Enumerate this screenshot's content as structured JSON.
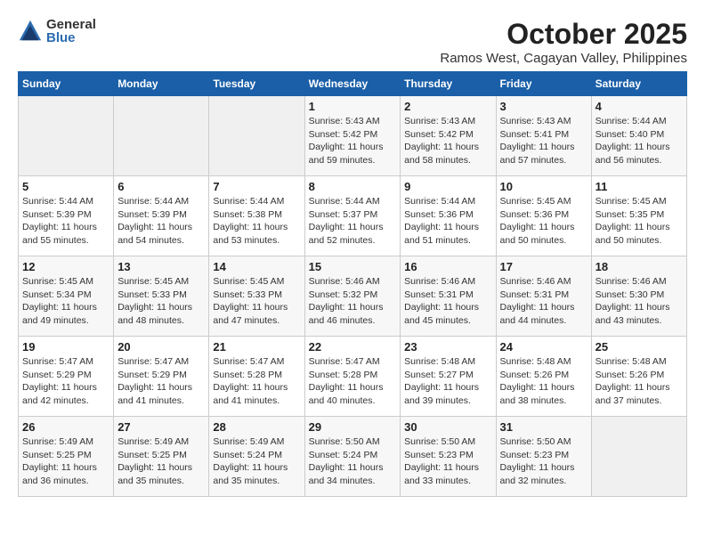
{
  "logo": {
    "general": "General",
    "blue": "Blue"
  },
  "title": "October 2025",
  "location": "Ramos West, Cagayan Valley, Philippines",
  "weekdays": [
    "Sunday",
    "Monday",
    "Tuesday",
    "Wednesday",
    "Thursday",
    "Friday",
    "Saturday"
  ],
  "weeks": [
    [
      {
        "day": "",
        "info": ""
      },
      {
        "day": "",
        "info": ""
      },
      {
        "day": "",
        "info": ""
      },
      {
        "day": "1",
        "info": "Sunrise: 5:43 AM\nSunset: 5:42 PM\nDaylight: 11 hours\nand 59 minutes."
      },
      {
        "day": "2",
        "info": "Sunrise: 5:43 AM\nSunset: 5:42 PM\nDaylight: 11 hours\nand 58 minutes."
      },
      {
        "day": "3",
        "info": "Sunrise: 5:43 AM\nSunset: 5:41 PM\nDaylight: 11 hours\nand 57 minutes."
      },
      {
        "day": "4",
        "info": "Sunrise: 5:44 AM\nSunset: 5:40 PM\nDaylight: 11 hours\nand 56 minutes."
      }
    ],
    [
      {
        "day": "5",
        "info": "Sunrise: 5:44 AM\nSunset: 5:39 PM\nDaylight: 11 hours\nand 55 minutes."
      },
      {
        "day": "6",
        "info": "Sunrise: 5:44 AM\nSunset: 5:39 PM\nDaylight: 11 hours\nand 54 minutes."
      },
      {
        "day": "7",
        "info": "Sunrise: 5:44 AM\nSunset: 5:38 PM\nDaylight: 11 hours\nand 53 minutes."
      },
      {
        "day": "8",
        "info": "Sunrise: 5:44 AM\nSunset: 5:37 PM\nDaylight: 11 hours\nand 52 minutes."
      },
      {
        "day": "9",
        "info": "Sunrise: 5:44 AM\nSunset: 5:36 PM\nDaylight: 11 hours\nand 51 minutes."
      },
      {
        "day": "10",
        "info": "Sunrise: 5:45 AM\nSunset: 5:36 PM\nDaylight: 11 hours\nand 50 minutes."
      },
      {
        "day": "11",
        "info": "Sunrise: 5:45 AM\nSunset: 5:35 PM\nDaylight: 11 hours\nand 50 minutes."
      }
    ],
    [
      {
        "day": "12",
        "info": "Sunrise: 5:45 AM\nSunset: 5:34 PM\nDaylight: 11 hours\nand 49 minutes."
      },
      {
        "day": "13",
        "info": "Sunrise: 5:45 AM\nSunset: 5:33 PM\nDaylight: 11 hours\nand 48 minutes."
      },
      {
        "day": "14",
        "info": "Sunrise: 5:45 AM\nSunset: 5:33 PM\nDaylight: 11 hours\nand 47 minutes."
      },
      {
        "day": "15",
        "info": "Sunrise: 5:46 AM\nSunset: 5:32 PM\nDaylight: 11 hours\nand 46 minutes."
      },
      {
        "day": "16",
        "info": "Sunrise: 5:46 AM\nSunset: 5:31 PM\nDaylight: 11 hours\nand 45 minutes."
      },
      {
        "day": "17",
        "info": "Sunrise: 5:46 AM\nSunset: 5:31 PM\nDaylight: 11 hours\nand 44 minutes."
      },
      {
        "day": "18",
        "info": "Sunrise: 5:46 AM\nSunset: 5:30 PM\nDaylight: 11 hours\nand 43 minutes."
      }
    ],
    [
      {
        "day": "19",
        "info": "Sunrise: 5:47 AM\nSunset: 5:29 PM\nDaylight: 11 hours\nand 42 minutes."
      },
      {
        "day": "20",
        "info": "Sunrise: 5:47 AM\nSunset: 5:29 PM\nDaylight: 11 hours\nand 41 minutes."
      },
      {
        "day": "21",
        "info": "Sunrise: 5:47 AM\nSunset: 5:28 PM\nDaylight: 11 hours\nand 41 minutes."
      },
      {
        "day": "22",
        "info": "Sunrise: 5:47 AM\nSunset: 5:28 PM\nDaylight: 11 hours\nand 40 minutes."
      },
      {
        "day": "23",
        "info": "Sunrise: 5:48 AM\nSunset: 5:27 PM\nDaylight: 11 hours\nand 39 minutes."
      },
      {
        "day": "24",
        "info": "Sunrise: 5:48 AM\nSunset: 5:26 PM\nDaylight: 11 hours\nand 38 minutes."
      },
      {
        "day": "25",
        "info": "Sunrise: 5:48 AM\nSunset: 5:26 PM\nDaylight: 11 hours\nand 37 minutes."
      }
    ],
    [
      {
        "day": "26",
        "info": "Sunrise: 5:49 AM\nSunset: 5:25 PM\nDaylight: 11 hours\nand 36 minutes."
      },
      {
        "day": "27",
        "info": "Sunrise: 5:49 AM\nSunset: 5:25 PM\nDaylight: 11 hours\nand 35 minutes."
      },
      {
        "day": "28",
        "info": "Sunrise: 5:49 AM\nSunset: 5:24 PM\nDaylight: 11 hours\nand 35 minutes."
      },
      {
        "day": "29",
        "info": "Sunrise: 5:50 AM\nSunset: 5:24 PM\nDaylight: 11 hours\nand 34 minutes."
      },
      {
        "day": "30",
        "info": "Sunrise: 5:50 AM\nSunset: 5:23 PM\nDaylight: 11 hours\nand 33 minutes."
      },
      {
        "day": "31",
        "info": "Sunrise: 5:50 AM\nSunset: 5:23 PM\nDaylight: 11 hours\nand 32 minutes."
      },
      {
        "day": "",
        "info": ""
      }
    ]
  ]
}
